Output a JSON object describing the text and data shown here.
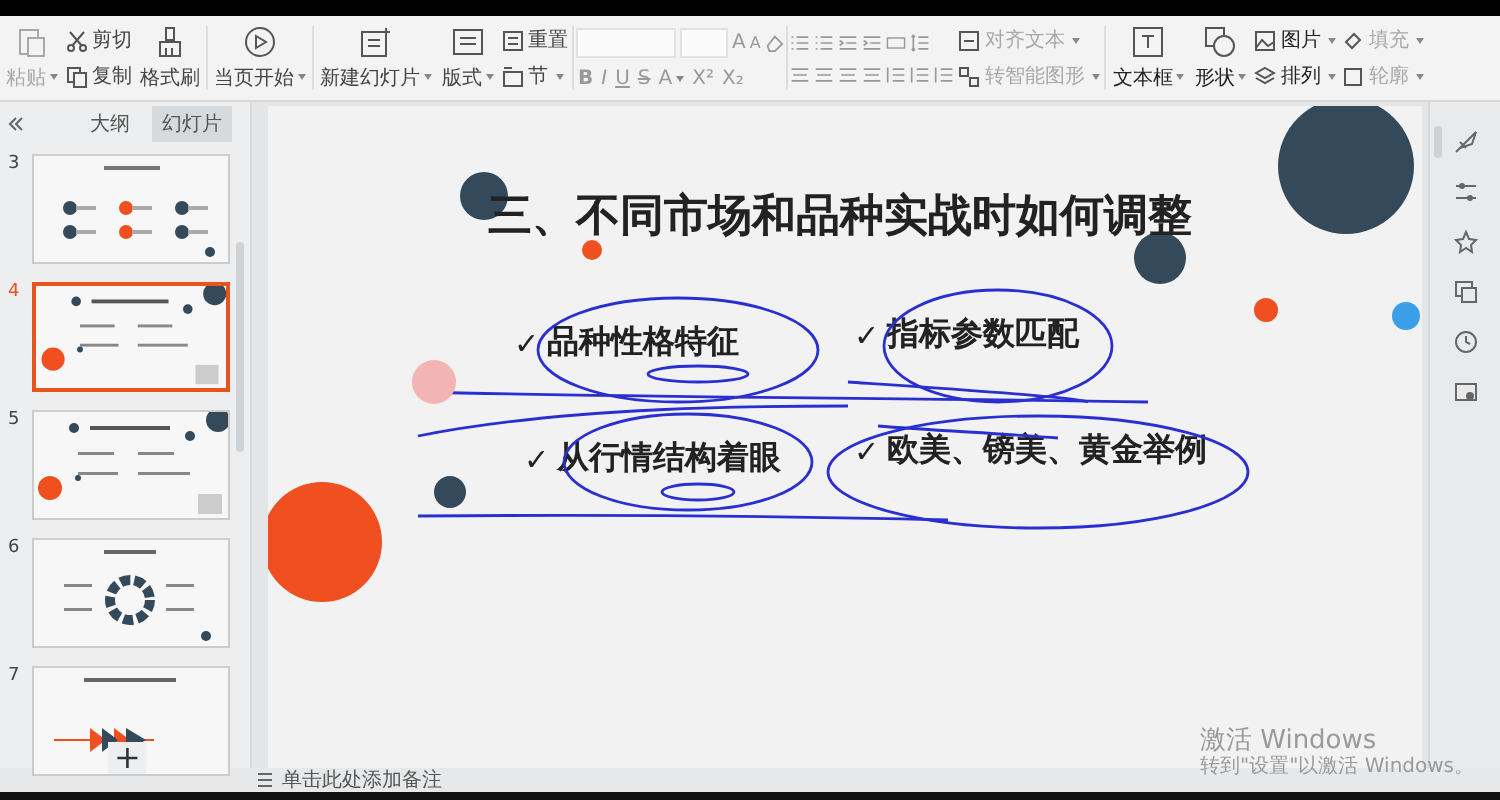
{
  "ribbon": {
    "paste": {
      "label": "粘贴",
      "disabled": true,
      "dropdown": true
    },
    "cut": {
      "label": "剪切",
      "disabled": false
    },
    "copy": {
      "label": "复制",
      "disabled": false
    },
    "format_painter": {
      "label": "格式刷",
      "disabled": false
    },
    "play_from_current": {
      "label": "当页开始",
      "dropdown": true
    },
    "new_slide": {
      "label": "新建幻灯片",
      "dropdown": true
    },
    "layout": {
      "label": "版式",
      "dropdown": true
    },
    "reset": {
      "label": "重置",
      "dropdown": false
    },
    "section": {
      "label": "节",
      "dropdown": true
    },
    "grow_font": "A",
    "shrink_font": "A",
    "format_buttons": [
      {
        "label": "B",
        "dropdown": false
      },
      {
        "label": "I",
        "dropdown": false
      },
      {
        "label": "U",
        "dropdown": false
      },
      {
        "label": "S",
        "dropdown": false
      },
      {
        "label": "A",
        "dropdown": true
      },
      {
        "label": "X²",
        "dropdown": false
      },
      {
        "label": "X₂",
        "dropdown": false
      }
    ],
    "align_text": {
      "label": "对齐文本",
      "disabled": true,
      "dropdown": true
    },
    "smart_art": {
      "label": "转智能图形",
      "disabled": true,
      "dropdown": true
    },
    "text_box": {
      "label": "文本框",
      "dropdown": true
    },
    "shape": {
      "label": "形状",
      "dropdown": true
    },
    "picture": {
      "label": "图片",
      "disabled": false,
      "dropdown": true
    },
    "arrange": {
      "label": "排列",
      "disabled": false,
      "dropdown": true
    },
    "fill": {
      "label": "填充",
      "disabled": true,
      "dropdown": true
    },
    "outline": {
      "label": "轮廓",
      "disabled": true,
      "dropdown": true
    }
  },
  "panel": {
    "tabs": [
      {
        "label": "大纲",
        "selected": false
      },
      {
        "label": "幻灯片",
        "selected": true
      }
    ],
    "thumbnails": [
      {
        "number": "3",
        "selected": false
      },
      {
        "number": "4",
        "selected": true
      },
      {
        "number": "5",
        "selected": false
      },
      {
        "number": "6",
        "selected": false
      },
      {
        "number": "7",
        "selected": false
      }
    ],
    "add_button": "+"
  },
  "slide": {
    "title": "三、不同市场和品种实战时如何调整",
    "bullets": [
      {
        "check": "✓",
        "text": "品种性格特征"
      },
      {
        "check": "✓",
        "text": "指标参数匹配"
      },
      {
        "check": "✓",
        "text": "从行情结构着眼"
      },
      {
        "check": "✓",
        "text": "欧美、镑美、黄金举例"
      }
    ]
  },
  "notes_placeholder": "单击此处添加备注",
  "activation": {
    "title": "激活 Windows",
    "subtitle": "转到\"设置\"以激活 Windows。"
  }
}
